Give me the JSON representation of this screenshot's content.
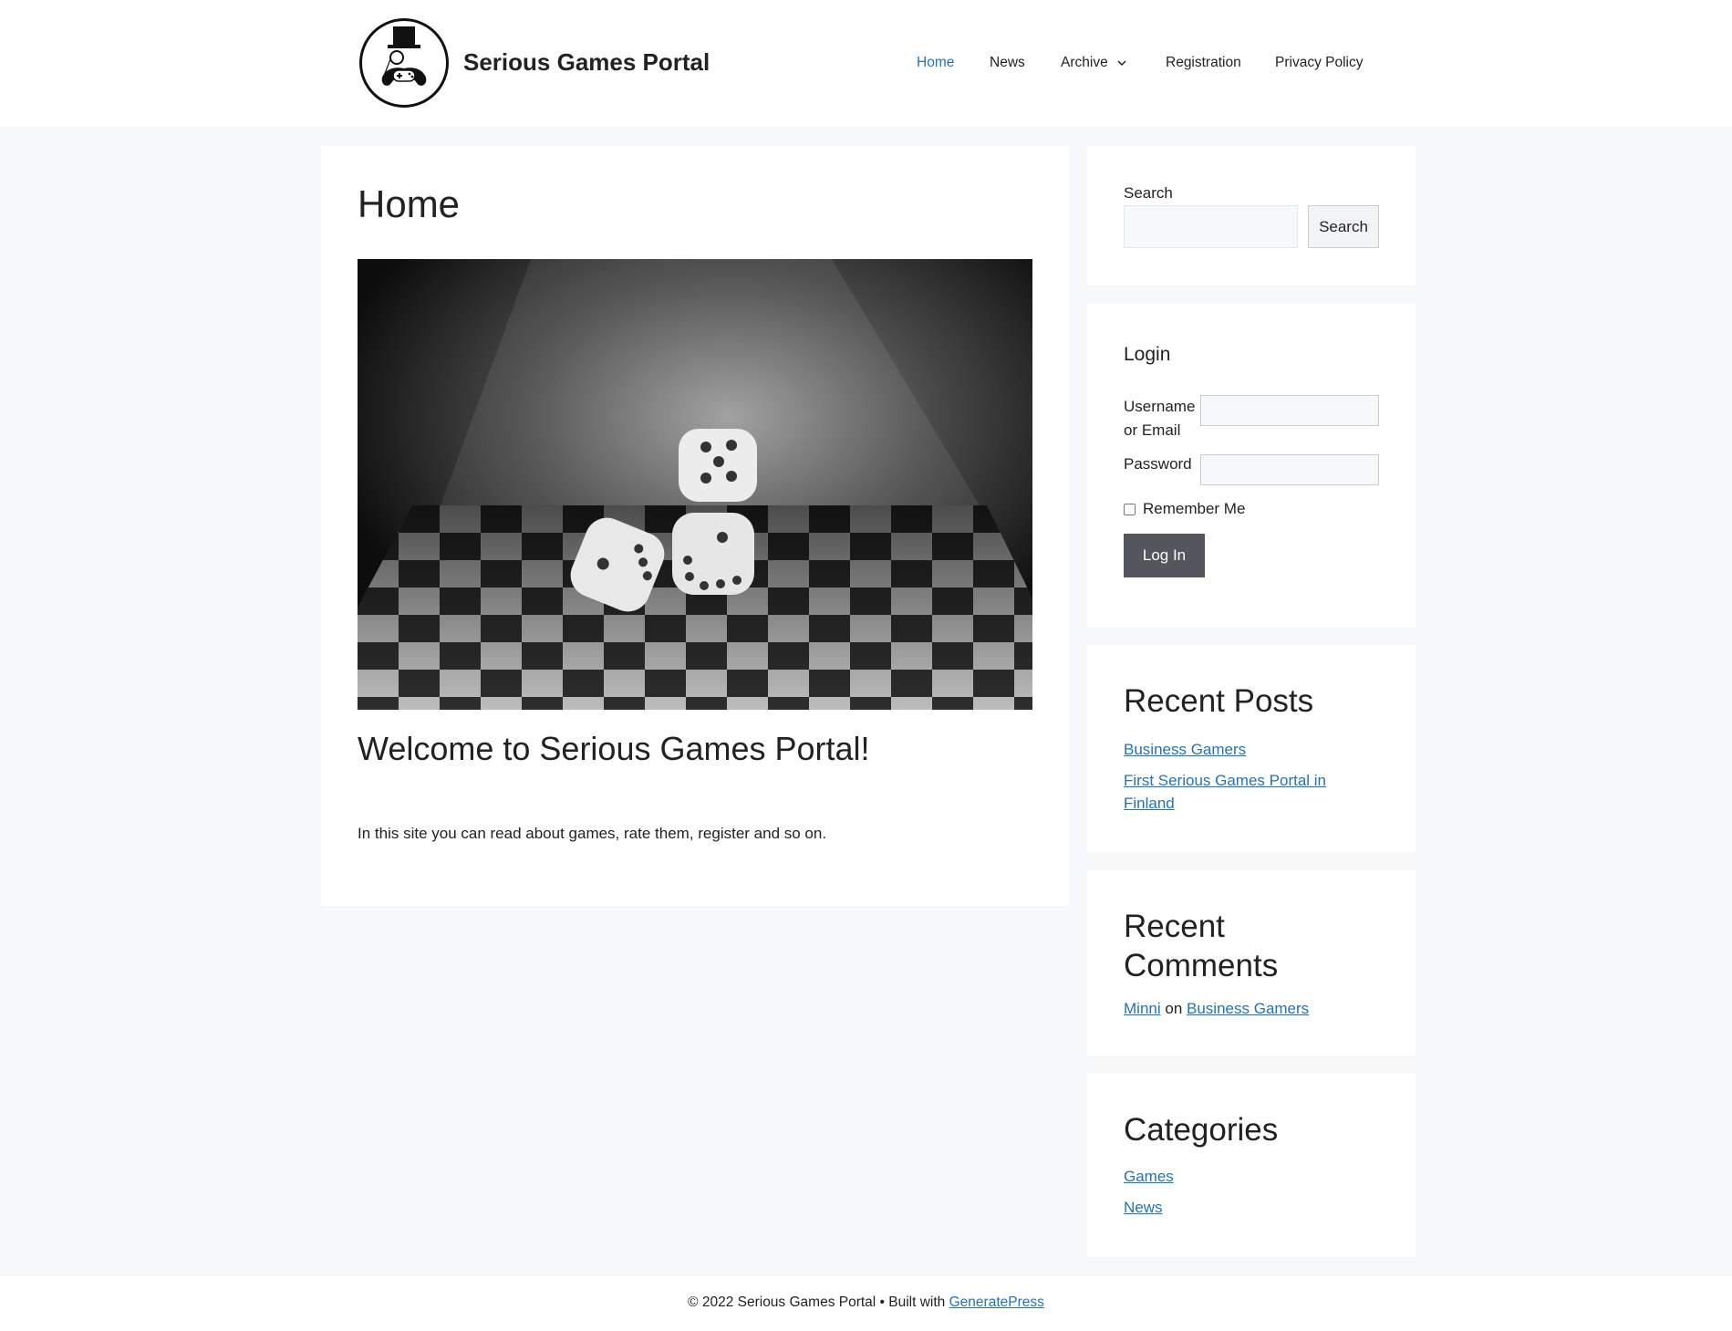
{
  "site": {
    "title": "Serious Games Portal"
  },
  "nav": {
    "items": [
      {
        "label": "Home",
        "active": true
      },
      {
        "label": "News"
      },
      {
        "label": "Archive",
        "has_dropdown": true
      },
      {
        "label": "Registration"
      },
      {
        "label": "Privacy Policy"
      }
    ]
  },
  "main": {
    "page_title": "Home",
    "welcome_heading": "Welcome to Serious Games Portal!",
    "intro_text": "In this site you can read about games, rate them, register and so on."
  },
  "sidebar": {
    "search": {
      "label": "Search",
      "button_label": "Search",
      "value": ""
    },
    "login": {
      "heading": "Login",
      "username_label": "Username or Email",
      "password_label": "Password",
      "remember_label": "Remember Me",
      "remember_checked": false,
      "button_label": "Log In"
    },
    "recent_posts": {
      "heading": "Recent Posts",
      "items": [
        "Business Gamers",
        "First Serious Games Portal in Finland"
      ]
    },
    "recent_comments": {
      "heading": "Recent Comments",
      "author": "Minni",
      "connector": "on",
      "post": "Business Gamers"
    },
    "categories": {
      "heading": "Categories",
      "items": [
        "Games",
        "News"
      ]
    }
  },
  "footer": {
    "text": "© 2022 Serious Games Portal • Built with",
    "link": "GeneratePress"
  },
  "colors": {
    "link": "#1e73be",
    "page_bg": "#f7f8f9",
    "button_bg": "#55555e"
  }
}
